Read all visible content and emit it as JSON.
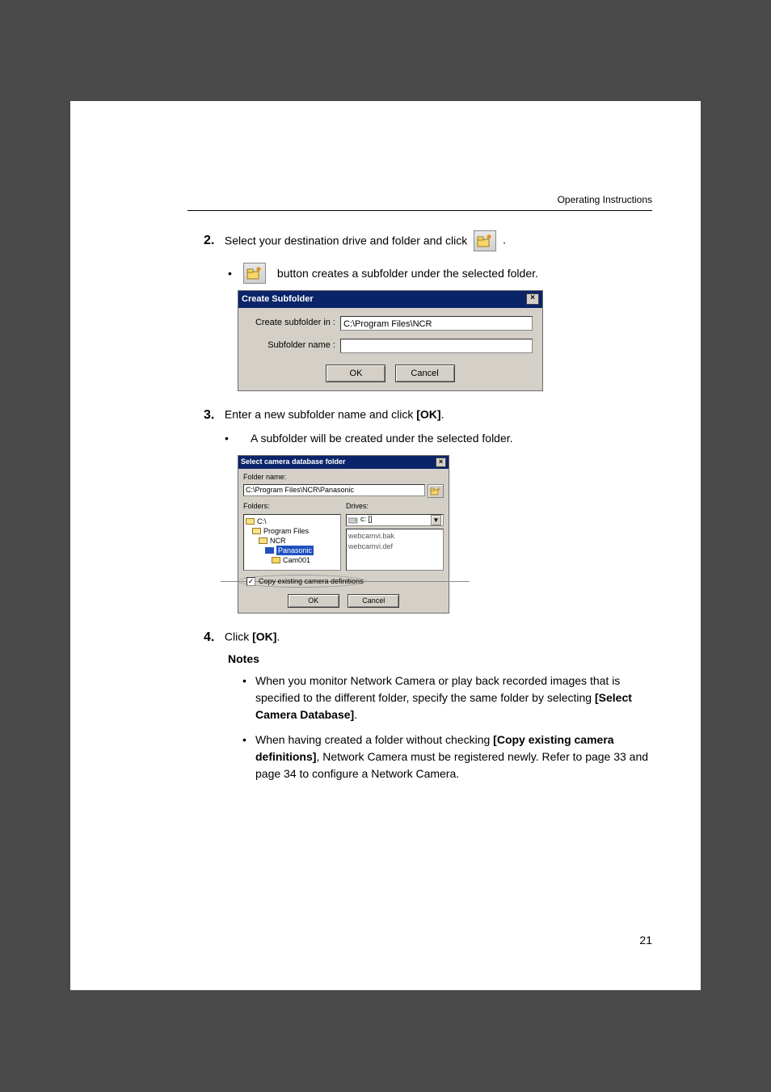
{
  "header": {
    "title": "Operating Instructions"
  },
  "step2": {
    "num": "2.",
    "text_before": "Select your destination drive and folder and click ",
    "text_after": " .",
    "bullet": " button creates a subfolder under the selected folder."
  },
  "dialog1": {
    "title": "Create Subfolder",
    "close": "×",
    "row1_label": "Create subfolder in :",
    "row1_value": "C:\\Program Files\\NCR",
    "row2_label": "Subfolder name :",
    "row2_value": "",
    "ok": "OK",
    "cancel": "Cancel"
  },
  "step3": {
    "num": "3.",
    "text": "Enter a new subfolder name and click ",
    "bold": "[OK]",
    "after": ".",
    "sub": "A subfolder will be created under the selected folder."
  },
  "dialog2": {
    "title": "Select camera database folder",
    "close": "×",
    "foldername_label": "Folder name:",
    "foldername_value": "C:\\Program Files\\NCR\\Panasonic",
    "folders_label": "Folders:",
    "drives_label": "Drives:",
    "drive_selected": "c: []",
    "tree": {
      "l0": "C:\\",
      "l1": "Program Files",
      "l2": "NCR",
      "l3": "Panasonic",
      "l4": "Cam001"
    },
    "files": {
      "f1": "webcamvi.bak",
      "f2": "webcamvi.def"
    },
    "checkbox_label": "Copy existing camera definitions",
    "ok": "OK",
    "cancel": "Cancel"
  },
  "step4": {
    "num": "4.",
    "text": "Click ",
    "bold": "[OK]",
    "after": "."
  },
  "notes": {
    "heading": "Notes",
    "item1_a": "When you monitor Network Camera or play back recorded images that is specified to the different folder, specify the same folder by selecting ",
    "item1_b": "[Select Camera Database]",
    "item1_c": ".",
    "item2_a": "When having created a folder without checking ",
    "item2_b": "[Copy existing camera definitions]",
    "item2_c": ", Network Camera must be registered newly. Refer to page 33 and page 34 to configure a Network Camera."
  },
  "pagenum": "21"
}
